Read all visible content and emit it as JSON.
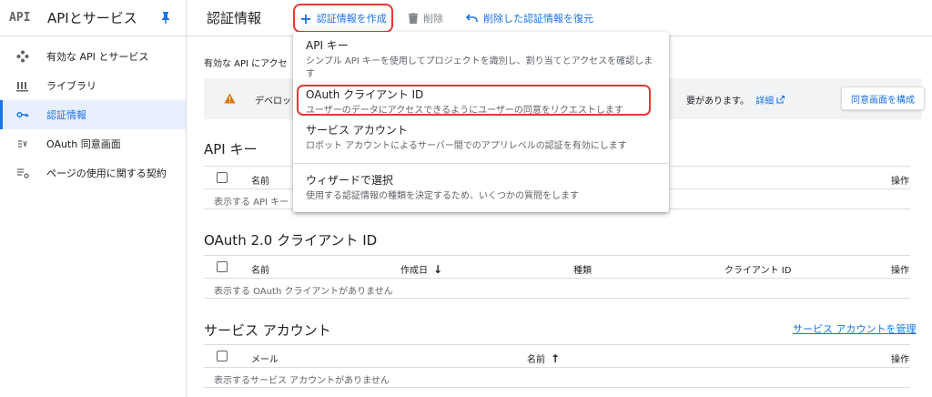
{
  "sidebar": {
    "logo": "API",
    "title": "APIとサービス",
    "items": [
      {
        "label": "有効な API とサービス",
        "icon": "diamond-nodes-icon"
      },
      {
        "label": "ライブラリ",
        "icon": "library-icon"
      },
      {
        "label": "認証情報",
        "icon": "key-icon"
      },
      {
        "label": "OAuth 同意画面",
        "icon": "consent-icon"
      },
      {
        "label": "ページの使用に関する契約",
        "icon": "settings-list-icon"
      }
    ]
  },
  "topbar": {
    "title": "認証情報",
    "create_label": "認証情報を作成",
    "delete_label": "削除",
    "restore_label": "削除した認証情報を復元"
  },
  "main": {
    "intro": "有効な API にアクセ",
    "banner_text": "デベロッ",
    "banner_tail": "要があります。",
    "banner_link": "詳細",
    "consent_button": "同意画面を構成",
    "api_keys": {
      "title": "API キー",
      "col_name": "名前",
      "col_action": "操作",
      "empty": "表示する API キー"
    },
    "oauth": {
      "title": "OAuth 2.0 クライアント ID",
      "col_name": "名前",
      "col_created": "作成日",
      "col_type": "種類",
      "col_client_id": "クライアント ID",
      "col_action": "操作",
      "empty": "表示する OAuth クライアントがありません"
    },
    "service_accounts": {
      "title": "サービス アカウント",
      "manage_link": "サービス アカウントを管理",
      "col_email": "メール",
      "col_name": "名前",
      "col_action": "操作",
      "empty": "表示するサービス アカウントがありません"
    }
  },
  "dropdown": {
    "items": [
      {
        "title": "API キー",
        "desc": "シンプル API キーを使用してプロジェクトを識別し、割り当てとアクセスを確認します"
      },
      {
        "title": "OAuth クライアント ID",
        "desc": "ユーザーのデータにアクセスできるようにユーザーの同意をリクエストします"
      },
      {
        "title": "サービス アカウント",
        "desc": "ロボット アカウントによるサーバー間でのアプリレベルの認証を有効にします"
      },
      {
        "title": "ウィザードで選択",
        "desc": "使用する認証情報の種類を決定するため、いくつかの質問をします"
      }
    ]
  },
  "colors": {
    "accent": "#1a73e8",
    "highlight": "#e53935",
    "warning": "#e37400"
  }
}
